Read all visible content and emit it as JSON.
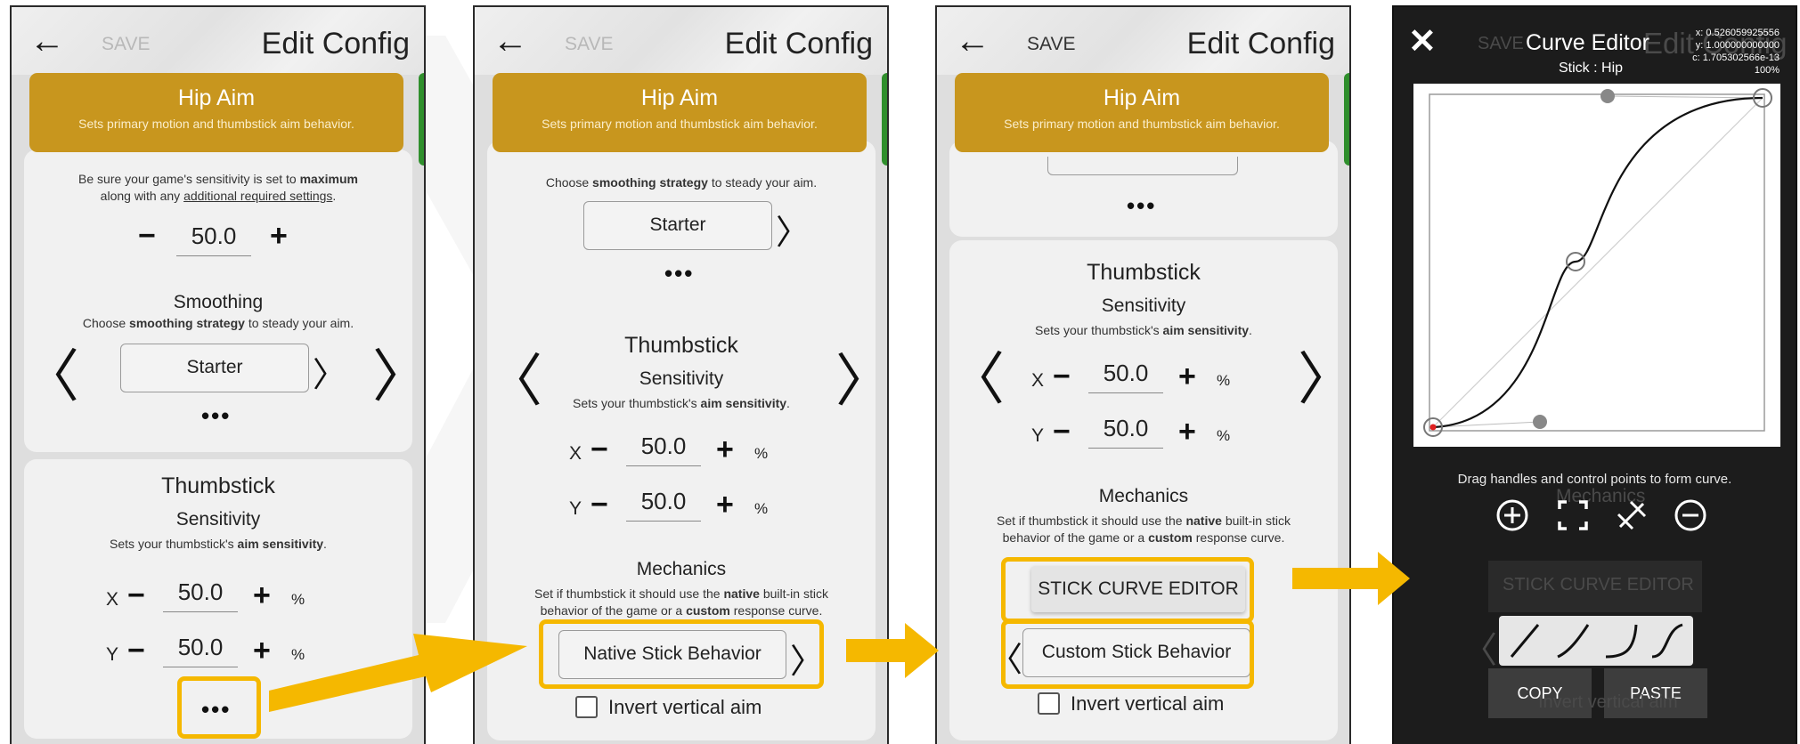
{
  "common": {
    "back_icon": "arrow-left-icon",
    "save_label": "SAVE",
    "title": "Edit Config",
    "banner_title": "Hip Aim",
    "banner_subtitle": "Sets primary motion and thumbstick aim behavior."
  },
  "panel1": {
    "sens_desc_prefix": "Be sure your game's sensitivity is set to ",
    "sens_desc_bold": "maximum",
    "sens_desc_line2_prefix": "along with any ",
    "sens_desc_link": "additional required settings",
    "sens_desc_line2_suffix": ".",
    "sens_value": "50.0",
    "smoothing_title": "Smoothing",
    "smoothing_desc_prefix": "Choose ",
    "smoothing_desc_bold": "smoothing strategy",
    "smoothing_desc_suffix": " to steady your aim.",
    "smoothing_value": "Starter",
    "more": "•••",
    "thumb_title": "Thumbstick",
    "thumb_sens_title": "Sensitivity",
    "thumb_sens_desc_prefix": "Sets your thumbstick's ",
    "thumb_sens_desc_bold": "aim sensitivity",
    "thumb_sens_desc_suffix": ".",
    "x_label": "X",
    "x_value": "50.0",
    "y_label": "Y",
    "y_value": "50.0",
    "unit": "%",
    "more2": "•••"
  },
  "panel2": {
    "smoothing_desc_prefix": "Choose ",
    "smoothing_desc_bold": "smoothing strategy",
    "smoothing_desc_suffix": " to steady your aim.",
    "smoothing_value": "Starter",
    "more": "•••",
    "thumb_title": "Thumbstick",
    "thumb_sens_title": "Sensitivity",
    "thumb_sens_desc_prefix": "Sets your thumbstick's ",
    "thumb_sens_desc_bold": "aim sensitivity",
    "thumb_sens_desc_suffix": ".",
    "x_label": "X",
    "x_value": "50.0",
    "y_label": "Y",
    "y_value": "50.0",
    "unit": "%",
    "mech_title": "Mechanics",
    "mech_desc1_prefix": "Set if thumbstick it should use the ",
    "mech_desc1_bold": "native",
    "mech_desc1_suffix": " built-in stick",
    "mech_desc2_prefix": "behavior of the game or a ",
    "mech_desc2_bold": "custom",
    "mech_desc2_suffix": " response curve.",
    "mech_value": "Native Stick Behavior",
    "invert_label": "Invert vertical aim"
  },
  "panel3": {
    "more": "•••",
    "thumb_title": "Thumbstick",
    "thumb_sens_title": "Sensitivity",
    "thumb_sens_desc_prefix": "Sets your thumbstick's ",
    "thumb_sens_desc_bold": "aim sensitivity",
    "thumb_sens_desc_suffix": ".",
    "x_label": "X",
    "x_value": "50.0",
    "y_label": "Y",
    "y_value": "50.0",
    "unit": "%",
    "mech_title": "Mechanics",
    "mech_desc1_prefix": "Set if thumbstick it should use the ",
    "mech_desc1_bold": "native",
    "mech_desc1_suffix": " built-in stick",
    "mech_desc2_prefix": "behavior of the game or a ",
    "mech_desc2_bold": "custom",
    "mech_desc2_suffix": " response curve.",
    "curve_editor_button": "STICK CURVE EDITOR",
    "mech_value": "Custom Stick Behavior",
    "invert_label": "Invert vertical aim"
  },
  "panel4": {
    "close_icon": "close-icon",
    "title": "Curve Editor",
    "subtitle": "Stick : Hip",
    "readout_x": "x: 0.526059925556",
    "readout_y": "y: 1.000000000000",
    "readout_c": "c: 1.705302566e-13",
    "zoom": "100%",
    "hint": "Drag handles and control points to form curve.",
    "icons": [
      "add-point-icon",
      "fit-frame-icon",
      "linear-reset-icon",
      "remove-point-icon"
    ],
    "preset_icons": [
      "linear-preset-icon",
      "steep-preset-icon",
      "ease-preset-icon",
      "s-curve-preset-icon"
    ],
    "copy_label": "COPY",
    "paste_label": "PASTE",
    "ghost_save": "SAVE",
    "ghost_title": "Edit Config",
    "ghost_mechanics": "Mechanics",
    "ghost_button": "STICK CURVE EDITOR",
    "ghost_invert": "Invert vertical aim"
  },
  "colors": {
    "banner": "#c8961e",
    "highlight": "#f5b800",
    "green_tab": "#2f8f2c"
  }
}
